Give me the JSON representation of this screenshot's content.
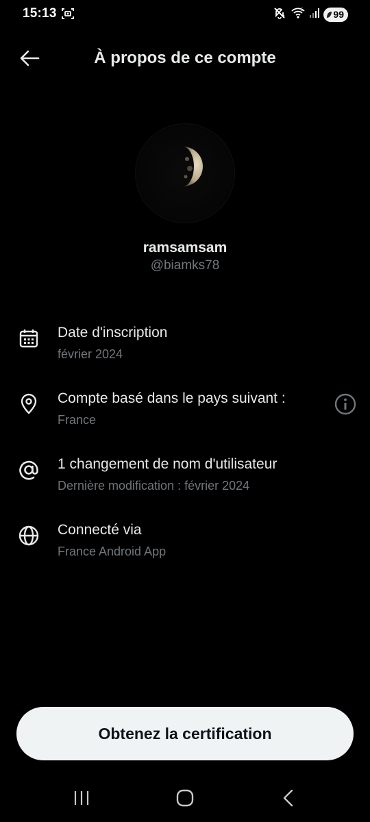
{
  "status_bar": {
    "time": "15:13",
    "battery": "99",
    "icons": [
      "screenshot-icon",
      "mute-icon",
      "wifi-icon",
      "signal-icon",
      "battery-icon"
    ]
  },
  "header": {
    "title": "À propos de ce compte",
    "back_icon": "arrow-left-icon"
  },
  "profile": {
    "display_name": "ramsamsam",
    "handle": "@biamks78",
    "avatar": "half-moon-photo"
  },
  "info_items": [
    {
      "icon": "calendar-icon",
      "label": "Date d'inscription",
      "value": "février 2024"
    },
    {
      "icon": "location-pin-icon",
      "label": "Compte basé dans le pays suivant :",
      "value": "France",
      "trailing_icon": "info-icon"
    },
    {
      "icon": "at-sign-icon",
      "label": "1 changement de nom d'utilisateur",
      "value": "Dernière modification : février 2024"
    },
    {
      "icon": "globe-icon",
      "label": "Connecté via",
      "value": "France Android App"
    }
  ],
  "cta": {
    "label": "Obtenez la certification"
  },
  "nav_bar": {
    "items": [
      "recents-icon",
      "home-icon",
      "back-icon"
    ]
  },
  "colors": {
    "background": "#000000",
    "primary_text": "#e7e9ea",
    "secondary_text": "#71767b",
    "button_bg": "#eff3f4",
    "button_text": "#0f1419"
  }
}
